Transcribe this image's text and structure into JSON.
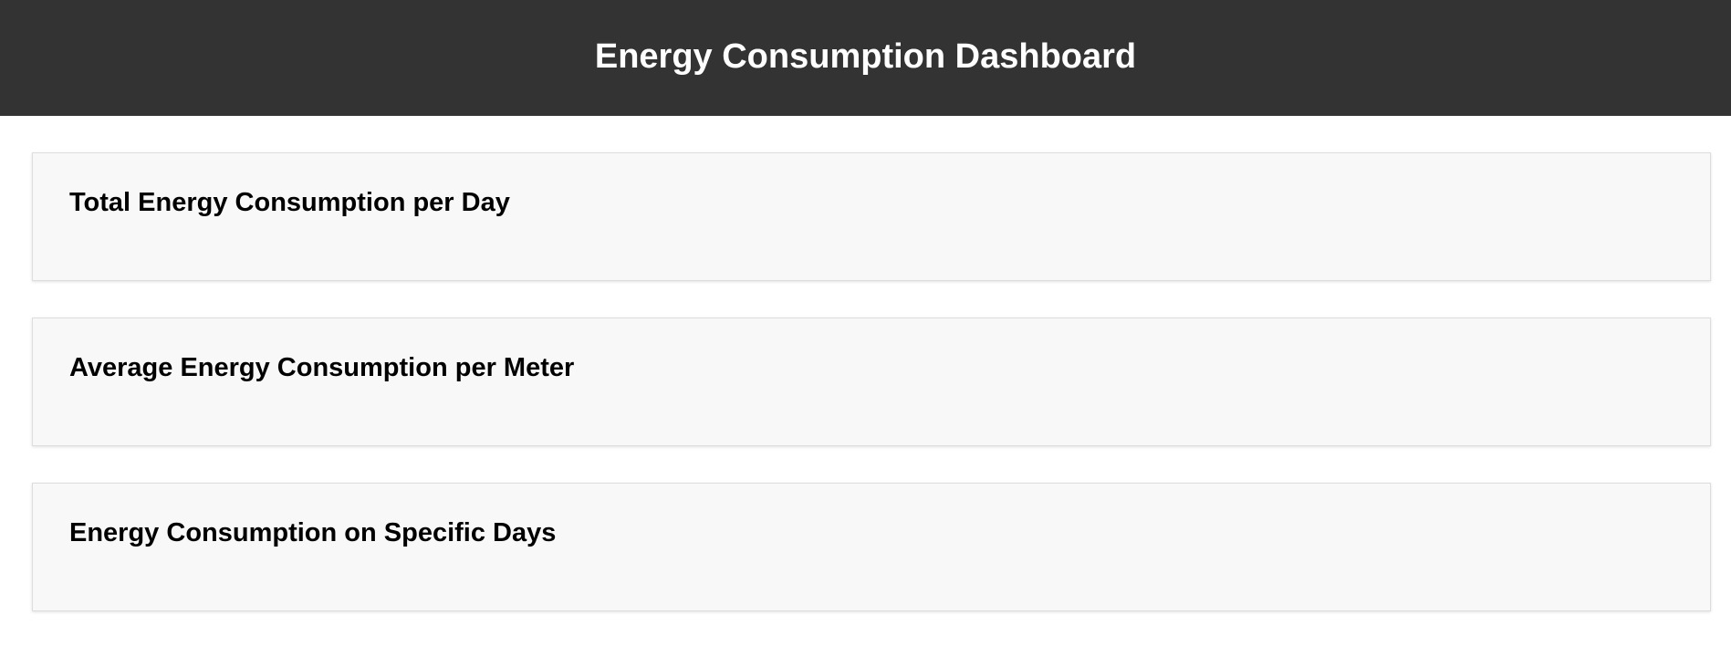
{
  "header": {
    "title": "Energy Consumption Dashboard"
  },
  "sections": [
    {
      "title": "Total Energy Consumption per Day"
    },
    {
      "title": "Average Energy Consumption per Meter"
    },
    {
      "title": "Energy Consumption on Specific Days"
    }
  ],
  "colors": {
    "header_background": "#333333",
    "header_text": "#ffffff",
    "card_background": "#f8f8f8",
    "card_border": "#dddddd"
  }
}
